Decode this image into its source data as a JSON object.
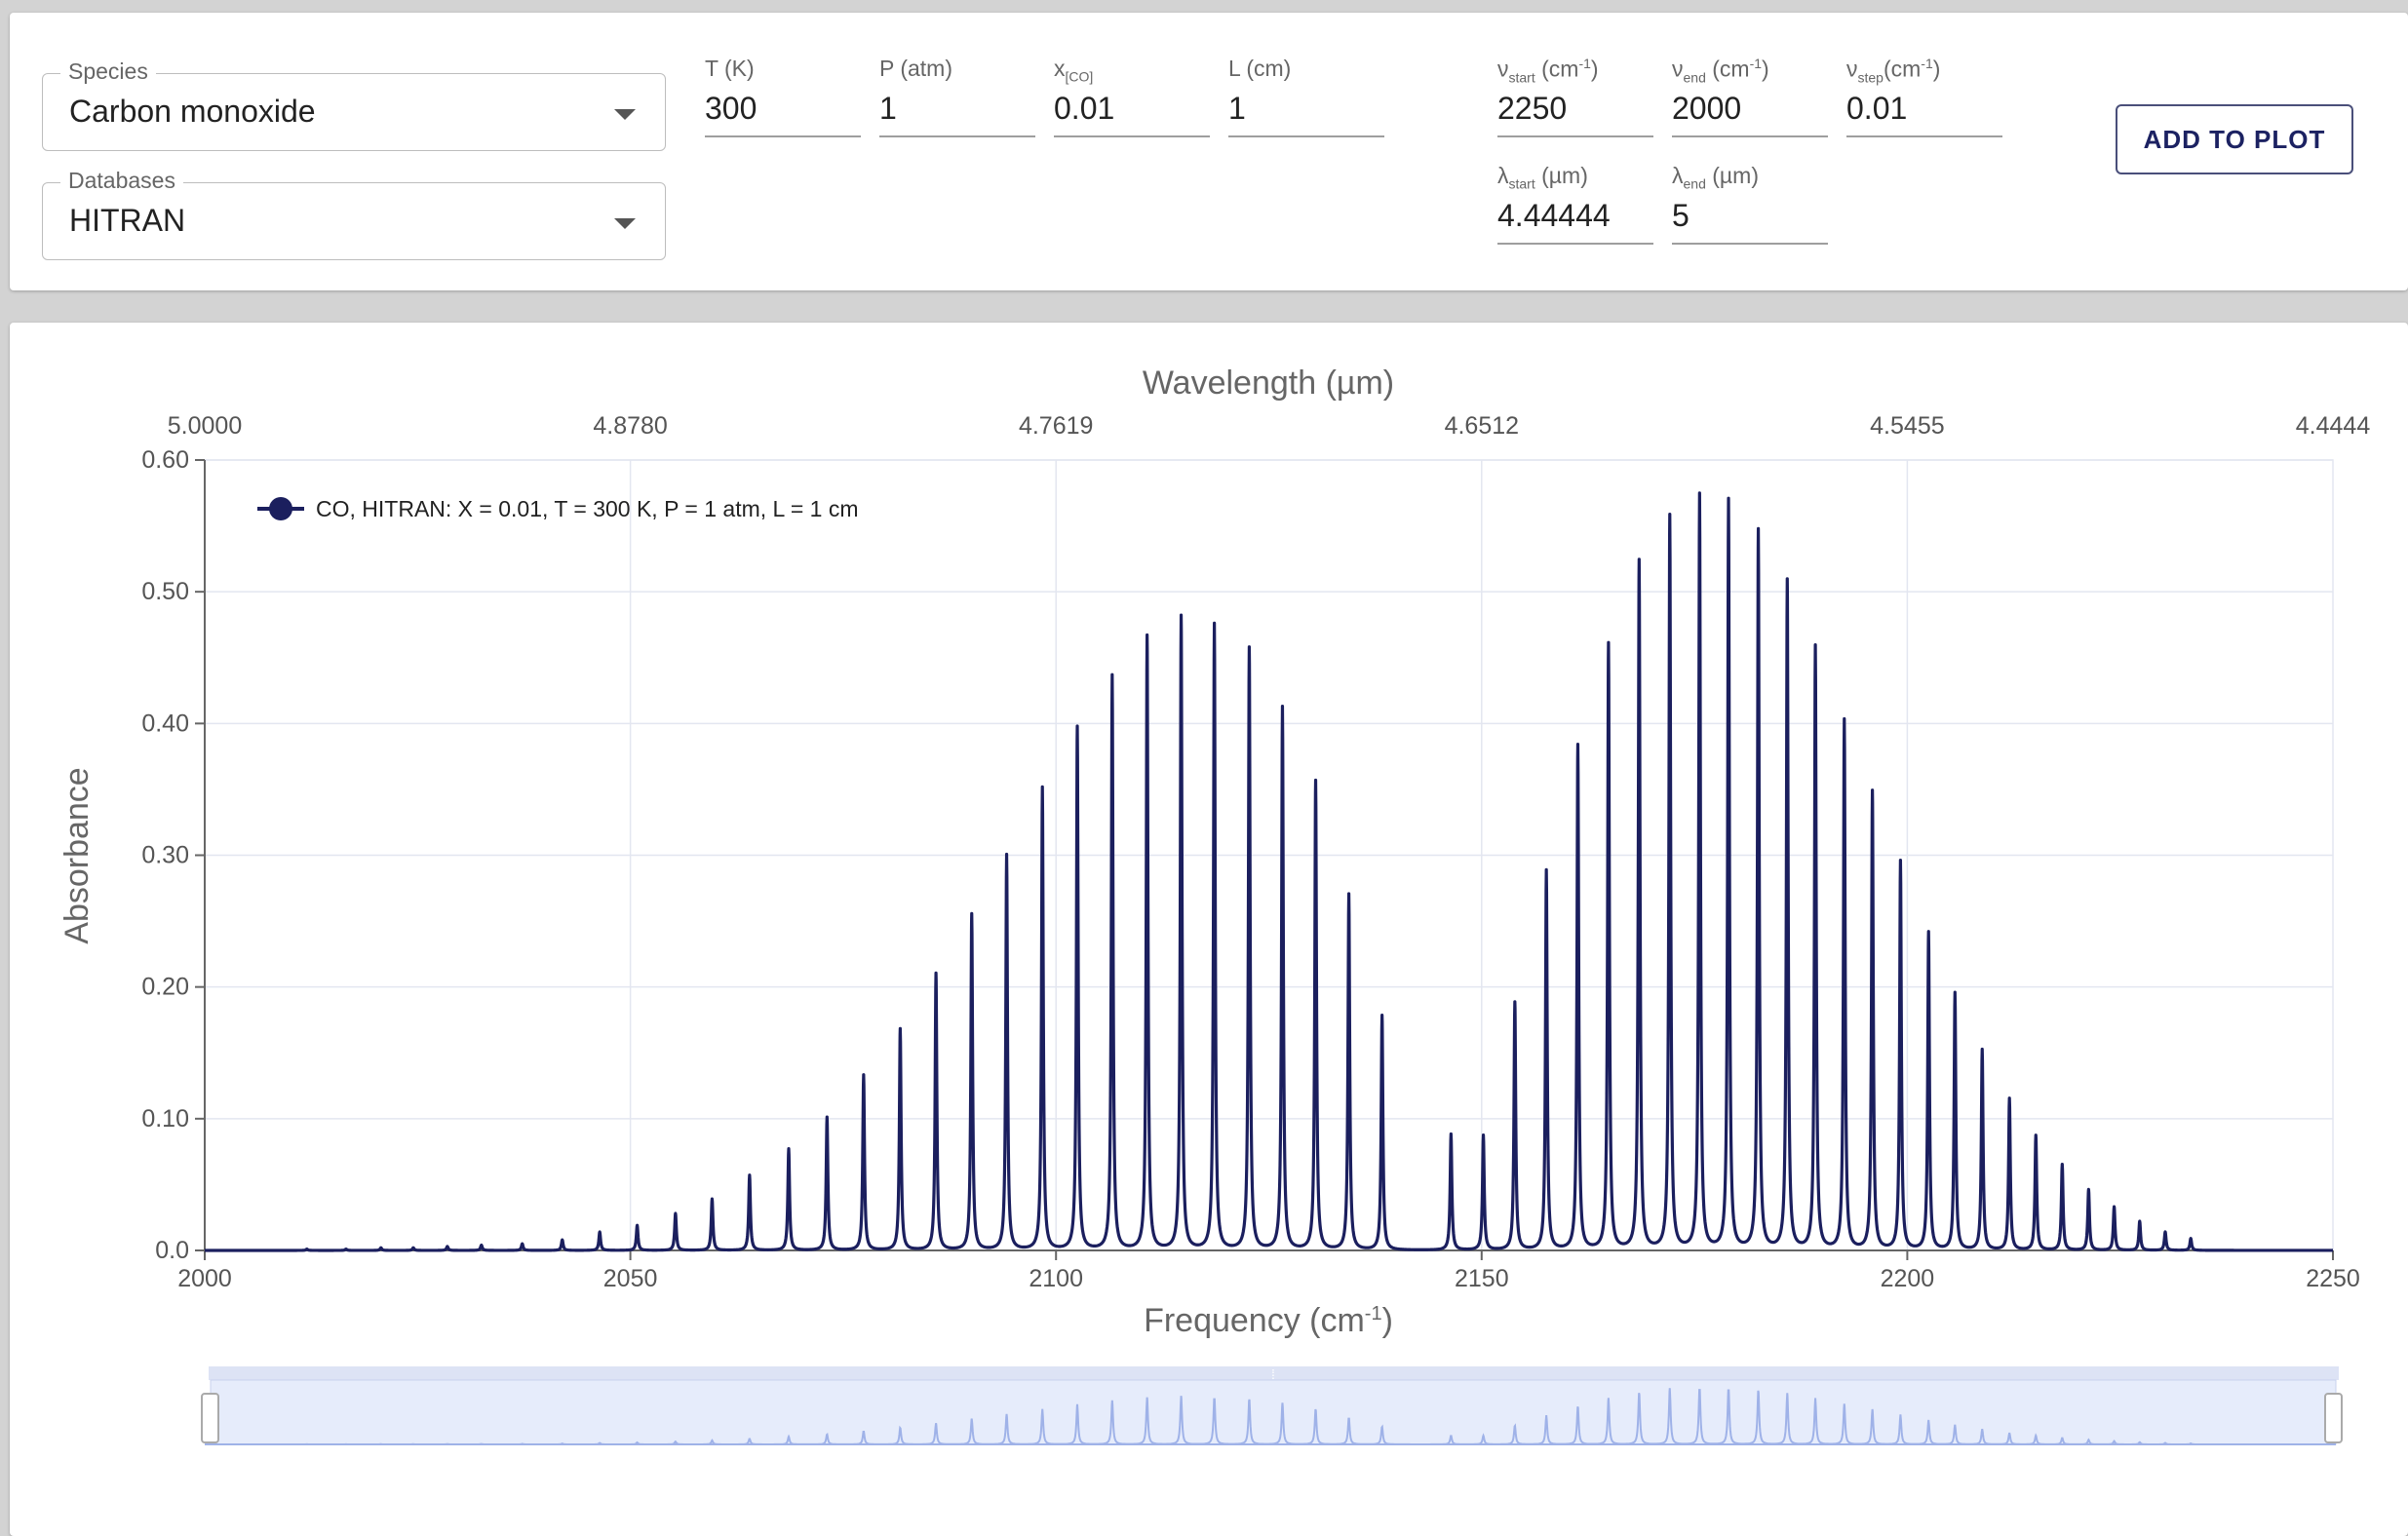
{
  "controls": {
    "species": {
      "label": "Species",
      "value": "Carbon monoxide"
    },
    "databases": {
      "label": "Databases",
      "value": "HITRAN"
    },
    "temperature": {
      "label": "T (K)",
      "value": "300"
    },
    "pressure": {
      "label": "P (atm)",
      "value": "1"
    },
    "mole_fraction": {
      "label_main": "x",
      "label_sub": "[CO]",
      "value": "0.01"
    },
    "path_length": {
      "label": "L (cm)",
      "value": "1"
    },
    "nu_start": {
      "label_main": "ν",
      "label_sub": "start",
      "label_unit": " (cm",
      "label_sup": "-1",
      "label_end": ")",
      "value": "2250"
    },
    "nu_end": {
      "label_main": "ν",
      "label_sub": "end",
      "label_unit": " (cm",
      "label_sup": "-1",
      "label_end": ")",
      "value": "2000"
    },
    "nu_step": {
      "label_main": "ν",
      "label_sub": "step",
      "label_unit": "(cm",
      "label_sup": "-1",
      "label_end": ")",
      "value": "0.01"
    },
    "lambda_start": {
      "label_main": "λ",
      "label_sub": "start",
      "label_unit": " (µm)",
      "value": "4.44444"
    },
    "lambda_end": {
      "label_main": "λ",
      "label_sub": "end",
      "label_unit": " (µm)",
      "value": "5"
    },
    "add_button_label": "ADD TO PLOT"
  },
  "plot": {
    "line_color": "#1b1f5e",
    "top_axis_title": "Wavelength (µm)",
    "top_tick_labels": [
      "5.0000",
      "4.8780",
      "4.7619",
      "4.6512",
      "4.5455",
      "4.4444"
    ],
    "x_axis_title_main": "Frequency (cm",
    "x_axis_title_sup": "-1",
    "x_axis_title_end": ")",
    "y_axis_title": "Absorbance",
    "y_tick_labels": [
      "0.0",
      "0.10",
      "0.20",
      "0.30",
      "0.40",
      "0.50",
      "0.60"
    ],
    "x_tick_labels": [
      "2000",
      "2050",
      "2100",
      "2150",
      "2200",
      "2250"
    ],
    "legend_text": "CO, HITRAN: X = 0.01, T = 300 K, P = 1 atm, L = 1 cm",
    "slider_handle_glyph": "⁞"
  },
  "chart_data": {
    "type": "line",
    "xlabel": "Frequency (cm-1)",
    "ylabel": "Absorbance",
    "x2label": "Wavelength (µm)",
    "xlim": [
      2000,
      2250
    ],
    "ylim": [
      0,
      0.6
    ],
    "grid": true,
    "legend_position": "top-left",
    "series": [
      {
        "name": "CO, HITRAN: X = 0.01, T = 300 K, P = 1 atm, L = 1 cm",
        "color": "#1b1f5e",
        "peaks_x": [
          2012.0,
          2016.6,
          2020.7,
          2024.5,
          2028.5,
          2032.5,
          2037.3,
          2042.0,
          2046.4,
          2050.8,
          2055.3,
          2059.6,
          2064.0,
          2068.6,
          2073.1,
          2077.4,
          2081.7,
          2085.9,
          2090.1,
          2094.2,
          2098.4,
          2102.5,
          2106.6,
          2110.7,
          2114.7,
          2118.6,
          2122.7,
          2126.6,
          2130.5,
          2134.4,
          2138.3,
          2146.4,
          2150.2,
          2153.9,
          2157.6,
          2161.3,
          2164.9,
          2168.5,
          2172.1,
          2175.6,
          2179.0,
          2182.5,
          2185.9,
          2189.2,
          2192.6,
          2195.9,
          2199.2,
          2202.5,
          2205.6,
          2208.8,
          2212.0,
          2215.1,
          2218.2,
          2221.3,
          2224.3,
          2227.3,
          2230.3,
          2233.3
        ],
        "peaks_y": [
          0.001,
          0.001,
          0.002,
          0.002,
          0.003,
          0.004,
          0.005,
          0.008,
          0.014,
          0.019,
          0.028,
          0.039,
          0.057,
          0.077,
          0.101,
          0.133,
          0.168,
          0.21,
          0.255,
          0.3,
          0.351,
          0.397,
          0.436,
          0.466,
          0.481,
          0.475,
          0.457,
          0.412,
          0.356,
          0.27,
          0.178,
          0.088,
          0.087,
          0.188,
          0.288,
          0.383,
          0.46,
          0.523,
          0.557,
          0.573,
          0.569,
          0.546,
          0.508,
          0.458,
          0.402,
          0.348,
          0.295,
          0.241,
          0.195,
          0.152,
          0.115,
          0.087,
          0.065,
          0.046,
          0.033,
          0.022,
          0.014,
          0.009
        ]
      }
    ]
  }
}
